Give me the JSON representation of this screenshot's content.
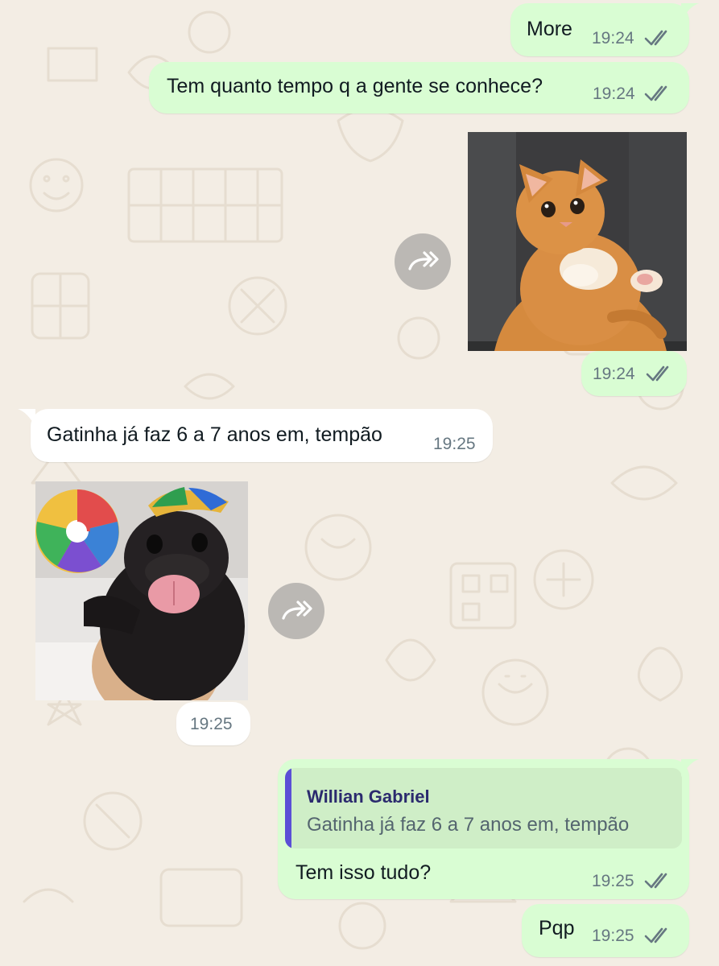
{
  "colors": {
    "wallpaper": "#f3ede4",
    "outgoing_bubble": "#d9fdd3",
    "incoming_bubble": "#ffffff",
    "read_ticks": "#667781",
    "quote_accent": "#5b4fd6"
  },
  "messages": [
    {
      "direction": "outgoing",
      "text": "More",
      "time": "19:24",
      "status": "read-ticks-icon"
    },
    {
      "direction": "outgoing",
      "text": "Tem quanto tempo q a gente se conhece?",
      "time": "19:24",
      "status": "read-ticks-icon"
    },
    {
      "direction": "outgoing",
      "type": "sticker",
      "sticker": "orange-kitten-sticker",
      "time": "19:24",
      "status": "read-ticks-icon"
    },
    {
      "direction": "incoming",
      "text": "Gatinha já faz 6 a 7 anos em, tempão",
      "time": "19:25"
    },
    {
      "direction": "incoming",
      "type": "sticker",
      "sticker": "pug-party-hat-lollipop-sticker",
      "time": "19:25"
    },
    {
      "direction": "outgoing",
      "quoted": {
        "author": "Willian Gabriel",
        "text": "Gatinha já faz 6 a 7 anos em, tempão"
      },
      "text": "Tem isso tudo?",
      "time": "19:25",
      "status": "read-ticks-icon"
    },
    {
      "direction": "outgoing",
      "text": "Pqp",
      "time": "19:25",
      "status": "read-ticks-icon"
    }
  ]
}
